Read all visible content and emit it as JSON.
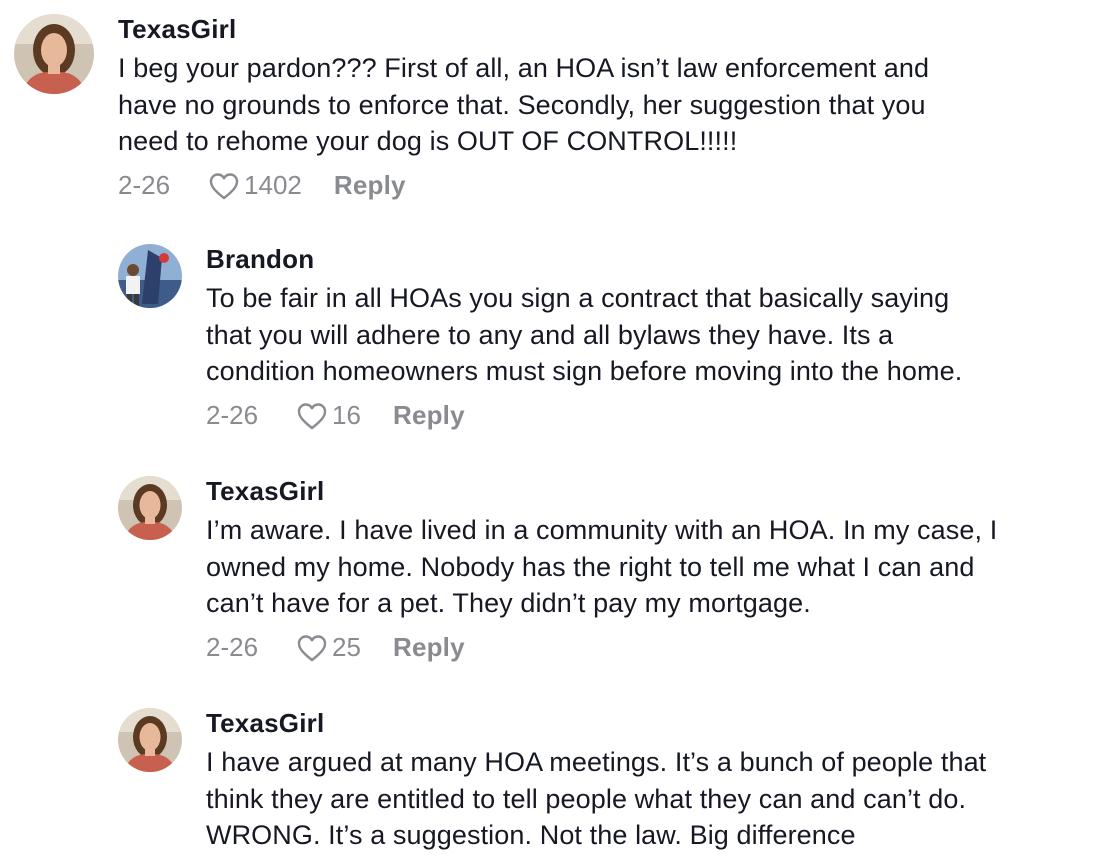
{
  "comments": [
    {
      "username": "TexasGirl",
      "avatar": "texasgirl-avatar",
      "text": "I beg your pardon??? First of all, an HOA isn’t law enforcement and\nhave no grounds to enforce that. Secondly, her suggestion that you\nneed to rehome your dog is OUT OF CONTROL!!!!!",
      "date": "2-26",
      "likes": "1402",
      "reply_label": "Reply"
    },
    {
      "username": "Brandon",
      "avatar": "brandon-avatar",
      "text": "To be fair in all HOAs you sign a contract that basically saying\nthat you will adhere to any and all bylaws they have. Its a\ncondition homeowners must sign before moving into the home.",
      "date": "2-26",
      "likes": "16",
      "reply_label": "Reply"
    },
    {
      "username": "TexasGirl",
      "avatar": "texasgirl-avatar",
      "text": "I’m aware. I have lived in a community with an HOA. In my case, I\nowned my home. Nobody has the right to tell me what I can and\ncan’t have for a pet. They didn’t pay my mortgage.",
      "date": "2-26",
      "likes": "25",
      "reply_label": "Reply"
    },
    {
      "username": "TexasGirl",
      "avatar": "texasgirl-avatar",
      "text": "I have argued at many HOA meetings. It’s a bunch of people that\nthink they are entitled to tell people what they can and can’t do.\nWRONG. It’s a suggestion. Not the law. Big difference"
    }
  ],
  "colors": {
    "text": "#161823",
    "muted": "#8a8b91",
    "background": "#ffffff"
  }
}
